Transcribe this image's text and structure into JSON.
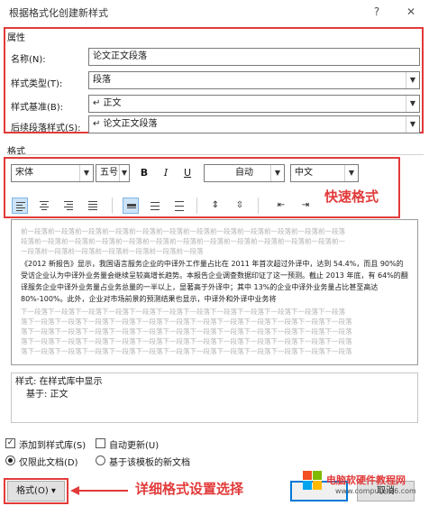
{
  "dialog": {
    "title": "根据格式化创建新样式",
    "help": "?",
    "close": "✕"
  },
  "properties": {
    "section_label": "属性",
    "name_label": "名称(N):",
    "name_value": "论文正文段落",
    "type_label": "样式类型(T):",
    "type_value": "段落",
    "based_on_label": "样式基准(B):",
    "based_on_value": "↵ 正文",
    "next_label": "后续段落样式(S):",
    "next_value": "↵ 论文正文段落"
  },
  "format": {
    "section_label": "格式",
    "font": "宋体",
    "size": "五号",
    "bold": "B",
    "italic": "I",
    "underline": "U",
    "color": "自动",
    "language": "中文",
    "annotation": "快速格式"
  },
  "preview": {
    "before_lines": [
      "前一段落前一段落前一段落前一段落前一段落前一段落前一段落前一段落前一段落前一段落前一段落前一段落",
      "段落前一段落前一段落前一段落前一段落前一段落前一段落前一段落前一段落前一段落前一段落前一段落前一",
      "一段落前一段落前一段落前一段落前一段落前一段落前一段落"
    ],
    "main_text": "《2012 新报告》显示，我国语言服务企业的中译外工作量占比在 2011 年首次超过外译中，达到 54.4%，而且 90%的受访企业认为中译外业务量会继续呈较高增长趋势。本报告企业调查数据印证了这一预测。截止 2013 年底，有 64%的翻译服务企业中译外业务量占业务总量的一半以上，显著高于外译中；其中 13%的企业中译外业务量占比甚至高达 80%-100%。此外，企业对市场前景的预测结果也显示，中译外和外译中业务将",
    "after_lines": [
      "下一段落下一段落下一段落下一段落下一段落下一段落下一段落下一段落下一段落下一段落下一段落下一段落",
      "落下一段落下一段落下一段落下一段落下一段落下一段落下一段落下一段落下一段落下一段落下一段落下一段落",
      "落下一段落下一段落下一段落下一段落下一段落下一段落下一段落下一段落下一段落下一段落下一段落下一段落",
      "落下一段落下一段落下一段落下一段落下一段落下一段落下一段落下一段落下一段落下一段落下一段落下一段落",
      "落下一段落下一段落下一段落下一段落下一段落下一段落下一段落下一段落下一段落下一段落下一段落下一段落"
    ]
  },
  "description": {
    "line1": "样式: 在样式库中显示",
    "line2": "基于: 正文"
  },
  "options": {
    "add_to_gallery": "添加到样式库(S)",
    "auto_update": "自动更新(U)",
    "only_this_doc": "仅限此文档(D)",
    "new_docs_template": "基于该模板的新文档"
  },
  "footer": {
    "format_button": "格式(O) ▾",
    "annotation": "详细格式设置选择",
    "cancel": "取消",
    "watermark_text": "电脑软硬件教程网",
    "watermark_url": "www.computer26.com"
  },
  "colors": {
    "annotation_red": "#e23a3a",
    "selected_blue": "#cde3f7"
  }
}
